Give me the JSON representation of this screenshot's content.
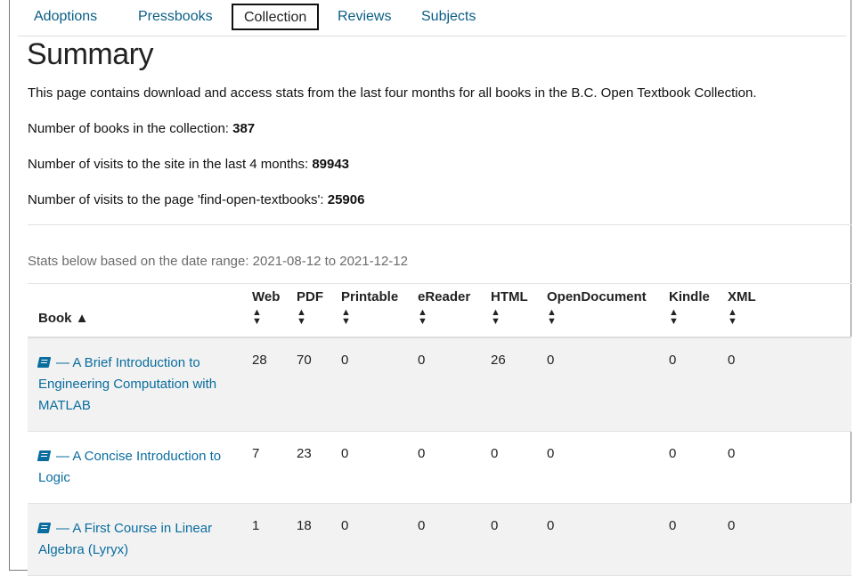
{
  "tabs": [
    {
      "label": "Adoptions"
    },
    {
      "label": "Pressbooks"
    },
    {
      "label": "Collection",
      "active": true
    },
    {
      "label": "Reviews"
    },
    {
      "label": "Subjects"
    }
  ],
  "summary": {
    "title": "Summary",
    "intro": "This page contains download and access stats from the last four months for all books in the B.C. Open Textbook Collection.",
    "books_label": "Number of books in the collection: ",
    "books_value": "387",
    "visits_label": "Number of visits to the site in the last 4 months: ",
    "visits_value": "89943",
    "page_visits_label": "Number of visits to the page 'find-open-textbooks': ",
    "page_visits_value": "25906"
  },
  "date_range": "Stats below based on the date range: 2021-08-12 to 2021-12-12",
  "table": {
    "headers": [
      "Book",
      "Web",
      "PDF",
      "Printable",
      "eReader",
      "HTML",
      "OpenDocument",
      "Kindle",
      "XML"
    ],
    "rows": [
      {
        "book": "— A Brief Introduction to Engineering Computation with MATLAB",
        "values": [
          "28",
          "70",
          "0",
          "0",
          "26",
          "0",
          "0",
          "0"
        ]
      },
      {
        "book": "— A Concise Introduction to Logic",
        "values": [
          "7",
          "23",
          "0",
          "0",
          "0",
          "0",
          "0",
          "0"
        ]
      },
      {
        "book": "— A First Course in Linear Algebra (Lyryx)",
        "values": [
          "1",
          "18",
          "0",
          "0",
          "0",
          "0",
          "0",
          "0"
        ]
      }
    ]
  },
  "colors": {
    "link": "#0a6d9e",
    "tab_link": "#0a5e84",
    "row_shade": "#f2f2f2"
  },
  "icons": {
    "book": "book-icon",
    "sort": "sort-icon"
  }
}
